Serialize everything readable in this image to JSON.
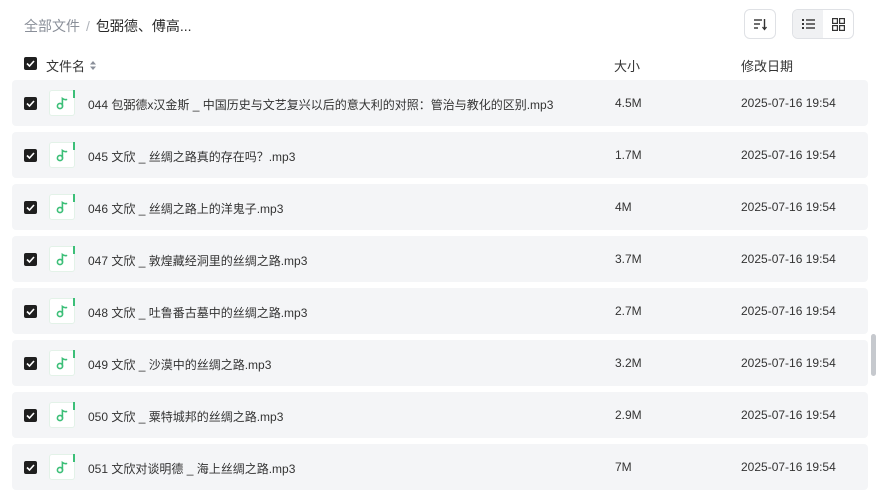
{
  "breadcrumb": {
    "root": "全部文件",
    "separator": "/",
    "current": "包弼德、傅高..."
  },
  "columns": {
    "name": "文件名",
    "size": "大小",
    "modified": "修改日期"
  },
  "files": [
    {
      "name": "044 包弼德x汉金斯 _ 中国历史与文艺复兴以后的意大利的对照：管治与教化的区别.mp3",
      "size": "4.5M",
      "modified": "2025-07-16 19:54",
      "checked": true
    },
    {
      "name": "045 文欣 _ 丝绸之路真的存在吗？.mp3",
      "size": "1.7M",
      "modified": "2025-07-16 19:54",
      "checked": true
    },
    {
      "name": "046 文欣 _ 丝绸之路上的洋鬼子.mp3",
      "size": "4M",
      "modified": "2025-07-16 19:54",
      "checked": true
    },
    {
      "name": "047 文欣 _ 敦煌藏经洞里的丝绸之路.mp3",
      "size": "3.7M",
      "modified": "2025-07-16 19:54",
      "checked": true
    },
    {
      "name": "048 文欣 _ 吐鲁番古墓中的丝绸之路.mp3",
      "size": "2.7M",
      "modified": "2025-07-16 19:54",
      "checked": true
    },
    {
      "name": "049 文欣 _ 沙漠中的丝绸之路.mp3",
      "size": "3.2M",
      "modified": "2025-07-16 19:54",
      "checked": true
    },
    {
      "name": "050 文欣 _ 粟特城邦的丝绸之路.mp3",
      "size": "2.9M",
      "modified": "2025-07-16 19:54",
      "checked": true
    },
    {
      "name": "051 文欣对谈明德 _ 海上丝绸之路.mp3",
      "size": "7M",
      "modified": "2025-07-16 19:54",
      "checked": true
    }
  ],
  "icons": {
    "file": "music-file-icon",
    "sort": "sort-icon",
    "list": "list-view-icon",
    "grid": "grid-view-icon",
    "column_sort": "sort-arrows-icon"
  },
  "colors": {
    "accent": "#3cbf78",
    "row_bg": "#f4f5f7",
    "checkbox": "#1f1f1f"
  }
}
